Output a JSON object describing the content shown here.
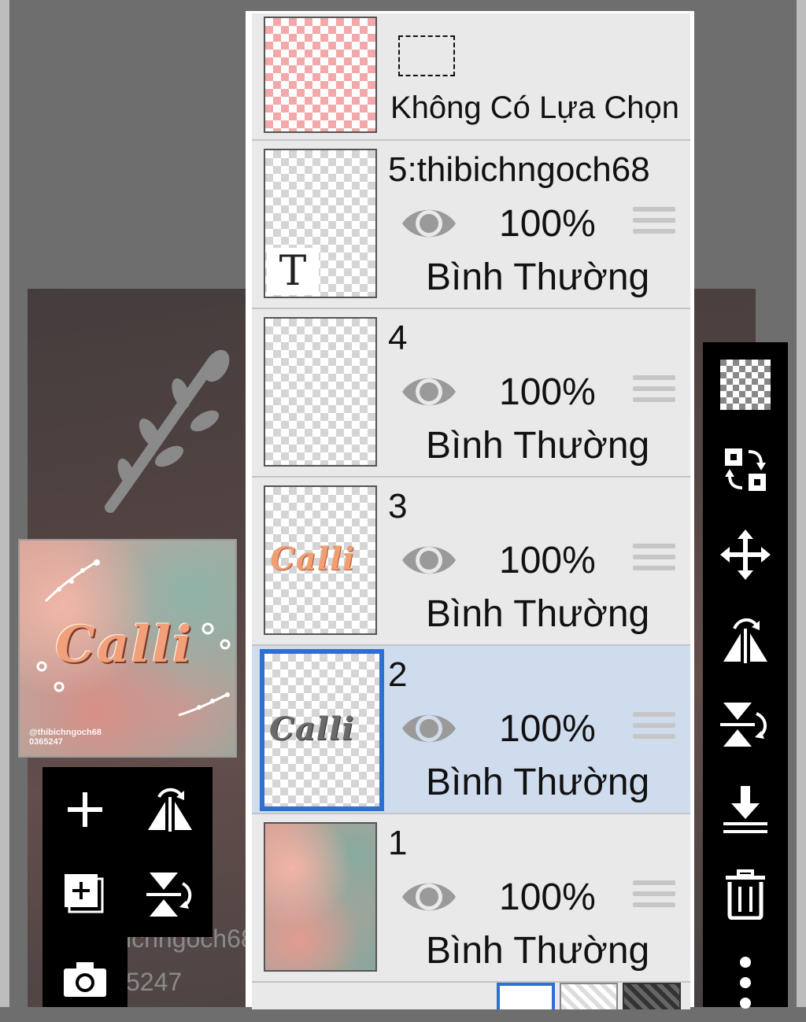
{
  "background_faint_text": {
    "handle": "ichngoch68",
    "number": "5247"
  },
  "preview": {
    "word": "Calli",
    "credit_line1": "@thibichngoch68",
    "credit_line2": "0365247"
  },
  "panel": {
    "selection_row": {
      "label": "Không Có Lựa Chọn"
    },
    "layers": [
      {
        "name": "5:thibichngoch68",
        "opacity": "100%",
        "blend": "Bình Thường",
        "thumb": "text"
      },
      {
        "name": "4",
        "opacity": "100%",
        "blend": "Bình Thường",
        "thumb": "empty"
      },
      {
        "name": "3",
        "opacity": "100%",
        "blend": "Bình Thường",
        "thumb": "calli-color",
        "thumb_word": "Calli"
      },
      {
        "name": "2",
        "opacity": "100%",
        "blend": "Bình Thường",
        "thumb": "calli-gray",
        "thumb_word": "Calli",
        "selected": true
      },
      {
        "name": "1",
        "opacity": "100%",
        "blend": "Bình Thường",
        "thumb": "sky"
      }
    ],
    "thumb_T": "T"
  },
  "colors": {
    "selected_border": "#2e6fd4",
    "selected_row": "#cfdcee",
    "toolbar": "#000000",
    "panel_bg": "#e9e9e9"
  },
  "left_toolbar": [
    "add-layer-icon",
    "flip-horizontal-icon",
    "duplicate-layer-icon",
    "flip-vertical-icon",
    "camera-icon"
  ],
  "right_toolbar": [
    "transparent-fill-icon",
    "swap-icon",
    "move-icon",
    "rotate-flip-horizontal-icon",
    "rotate-flip-vertical-icon",
    "merge-down-icon",
    "trash-icon",
    "more-icon"
  ]
}
